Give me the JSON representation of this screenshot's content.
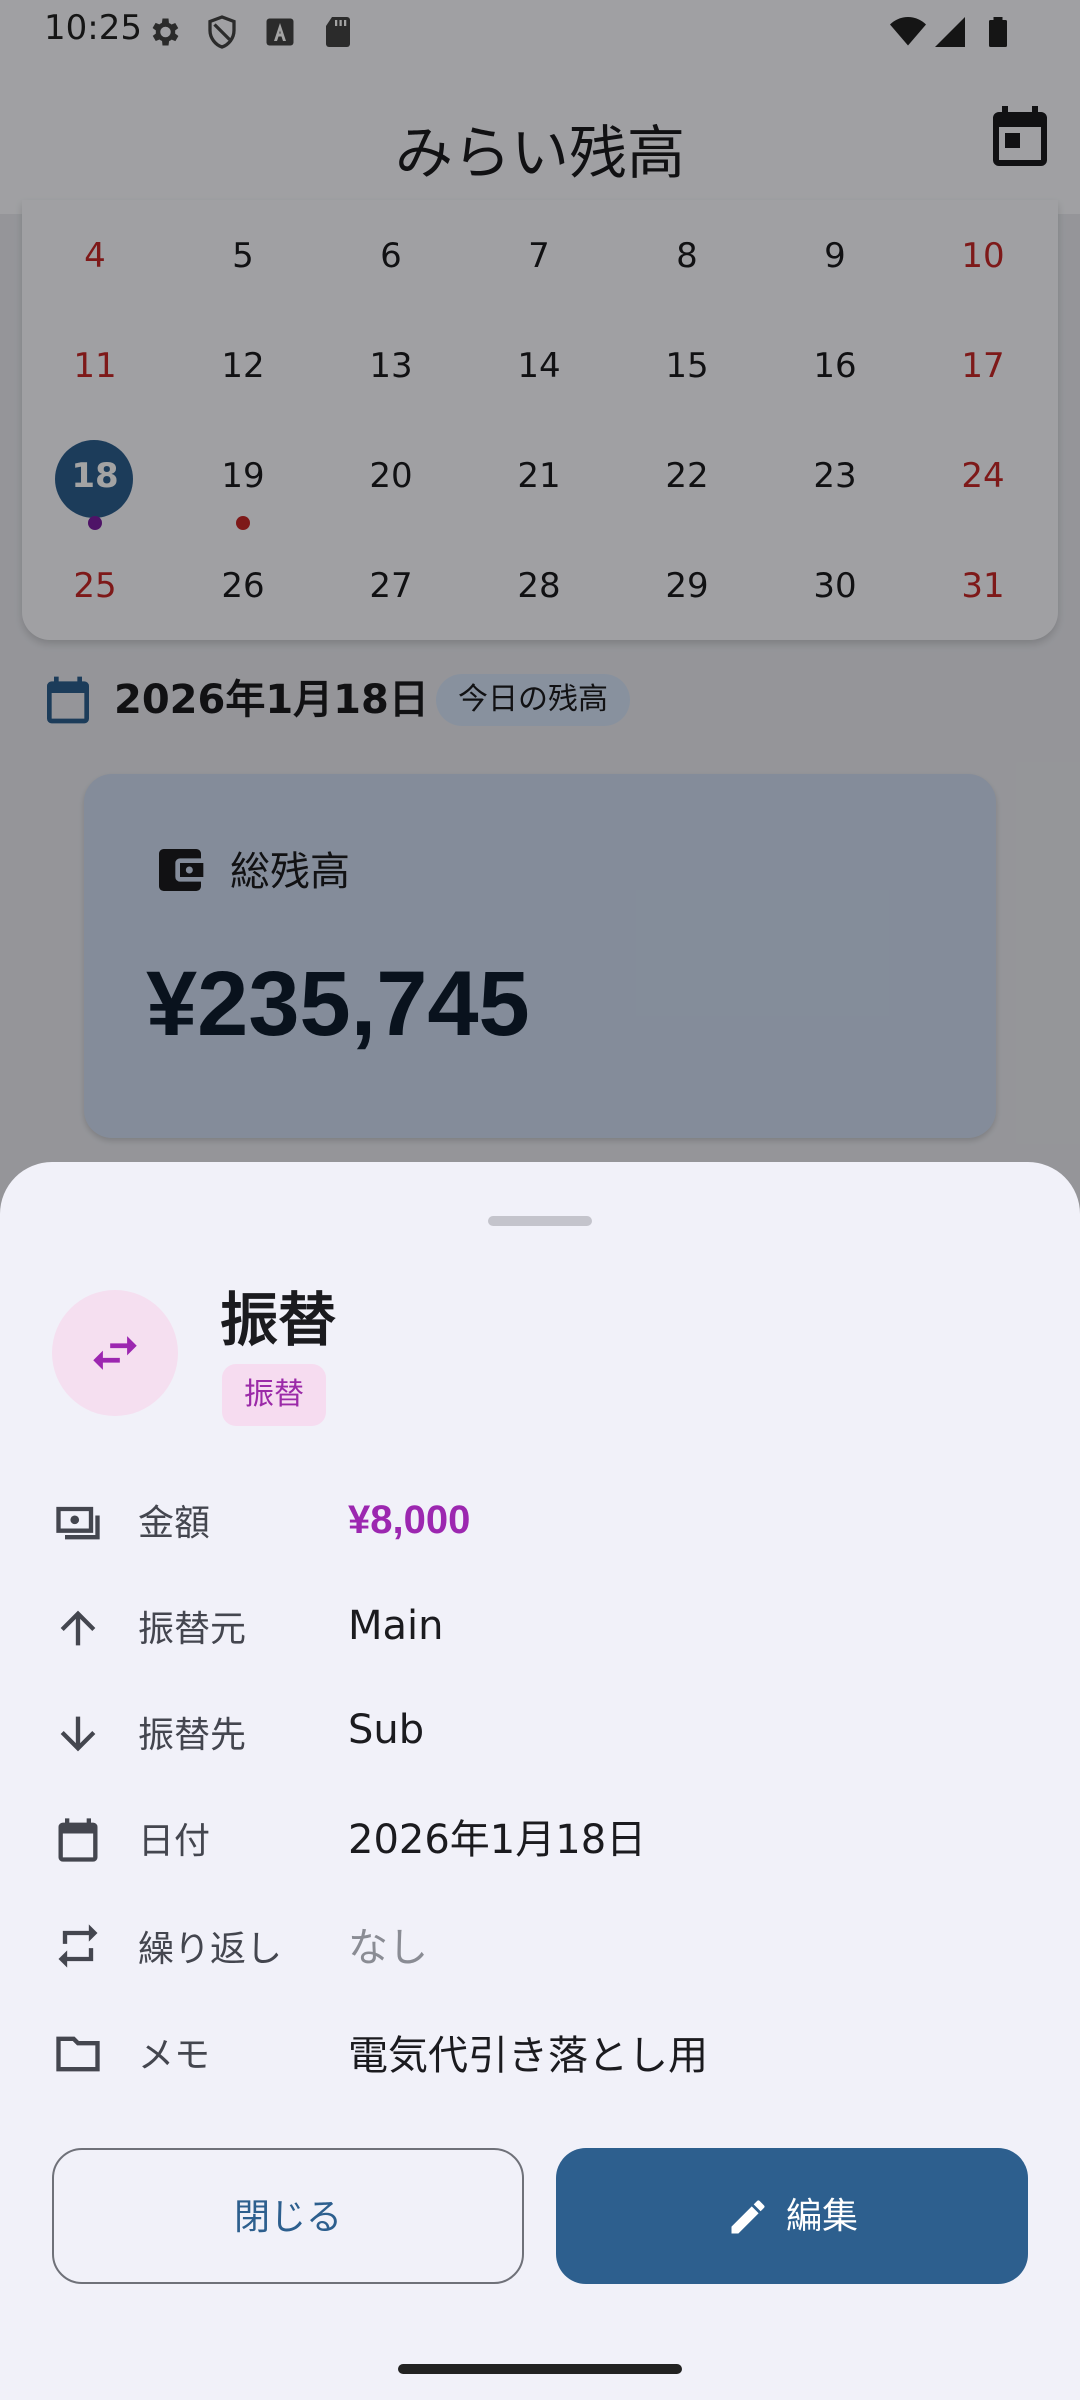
{
  "status_bar": {
    "time": "10:25"
  },
  "app_bar": {
    "title": "みらい残高"
  },
  "calendar": {
    "rows": [
      [
        "4",
        "5",
        "6",
        "7",
        "8",
        "9",
        "10"
      ],
      [
        "11",
        "12",
        "13",
        "14",
        "15",
        "16",
        "17"
      ],
      [
        "18",
        "19",
        "20",
        "21",
        "22",
        "23",
        "24"
      ],
      [
        "25",
        "26",
        "27",
        "28",
        "29",
        "30",
        "31"
      ]
    ],
    "today": "18"
  },
  "selected_date": {
    "text": "2026年1月18日",
    "chip": "今日の残高"
  },
  "balance_card": {
    "label": "総残高",
    "value": "¥235,745"
  },
  "sheet": {
    "title": "振替",
    "type_chip": "振替",
    "rows": [
      {
        "icon": "cash-icon",
        "label": "金額",
        "value": "¥8,000"
      },
      {
        "icon": "arrow-up-icon",
        "label": "振替元",
        "value": "Main"
      },
      {
        "icon": "arrow-down-icon",
        "label": "振替先",
        "value": "Sub"
      },
      {
        "icon": "calendar-icon",
        "label": "日付",
        "value": "2026年1月18日"
      },
      {
        "icon": "repeat-icon",
        "label": "繰り返し",
        "value": "なし"
      },
      {
        "icon": "folder-icon",
        "label": "メモ",
        "value": "電気代引き落とし用"
      }
    ],
    "close_label": "閉じる",
    "edit_label": "編集"
  },
  "colors": {
    "primary": "#2d5f8e",
    "transfer_accent": "#9c27b0",
    "weekend_red": "#c62828"
  }
}
